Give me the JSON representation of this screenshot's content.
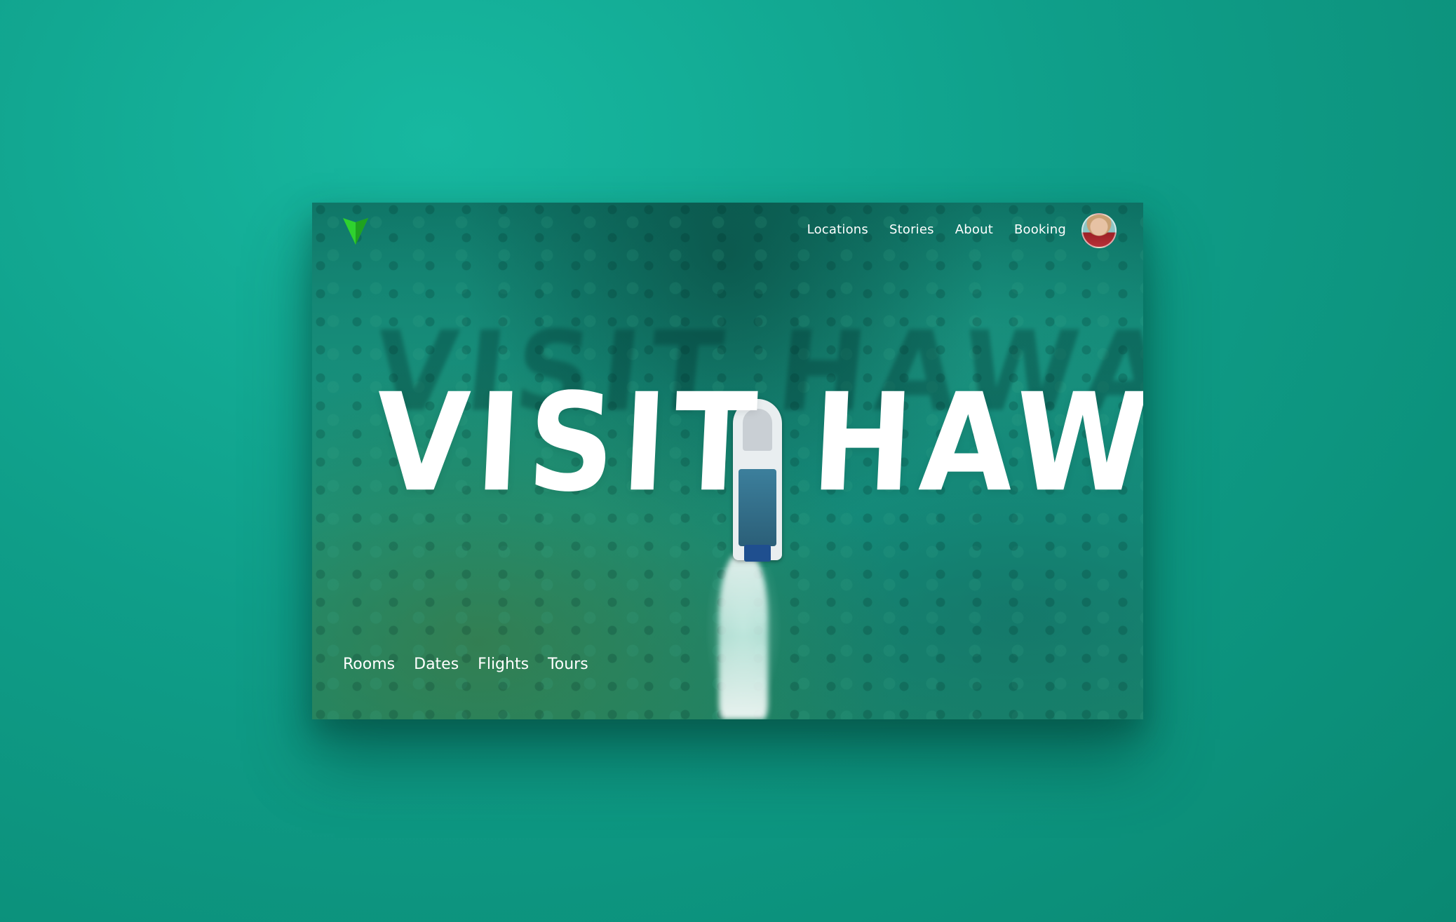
{
  "nav": {
    "items": [
      {
        "label": "Locations"
      },
      {
        "label": "Stories"
      },
      {
        "label": "About"
      },
      {
        "label": "Booking"
      }
    ]
  },
  "hero": {
    "title": "VISIT HAWAII"
  },
  "bottom_nav": {
    "items": [
      {
        "label": "Rooms"
      },
      {
        "label": "Dates"
      },
      {
        "label": "Flights"
      },
      {
        "label": "Tours"
      }
    ]
  },
  "brand": {
    "logo_icon": "green-arrow-logo-icon",
    "logo_color": "#2fd12f"
  },
  "colors": {
    "page_background": "#12a891",
    "text": "#ffffff"
  }
}
